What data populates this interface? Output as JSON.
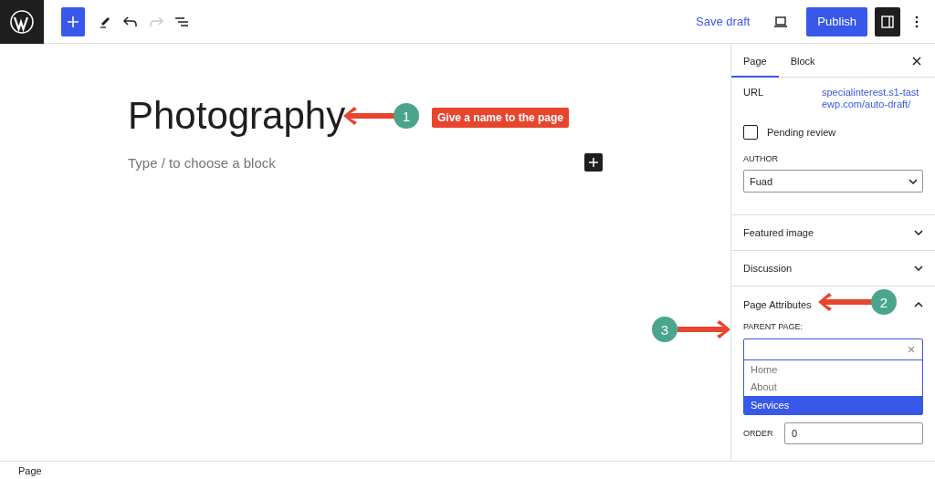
{
  "toolbar": {
    "save_draft": "Save draft",
    "publish": "Publish"
  },
  "editor": {
    "title": "Photography",
    "placeholder": "Type / to choose a block"
  },
  "sidebar": {
    "tabs": [
      {
        "label": "Page",
        "selected": true
      },
      {
        "label": "Block",
        "selected": false
      }
    ],
    "url": {
      "label": "URL",
      "value": "specialinterest.s1-tastewp.com/auto-draft/"
    },
    "pending_review": {
      "label": "Pending review",
      "checked": false
    },
    "author": {
      "label": "AUTHOR",
      "value": "Fuad"
    },
    "panels": [
      {
        "title": "Featured image",
        "expanded": false
      },
      {
        "title": "Discussion",
        "expanded": false
      },
      {
        "title": "Page Attributes",
        "expanded": true
      }
    ],
    "parent_page": {
      "label": "PARENT PAGE:",
      "options": [
        {
          "label": "Home",
          "selected": false
        },
        {
          "label": "About",
          "selected": false
        },
        {
          "label": "Services",
          "selected": true
        }
      ]
    },
    "order": {
      "label": "ORDER",
      "value": "0"
    }
  },
  "annotations": [
    {
      "number": "1",
      "label": "Give a name to the page"
    },
    {
      "number": "2"
    },
    {
      "number": "3"
    }
  ],
  "status_bar": {
    "text": "Page"
  }
}
